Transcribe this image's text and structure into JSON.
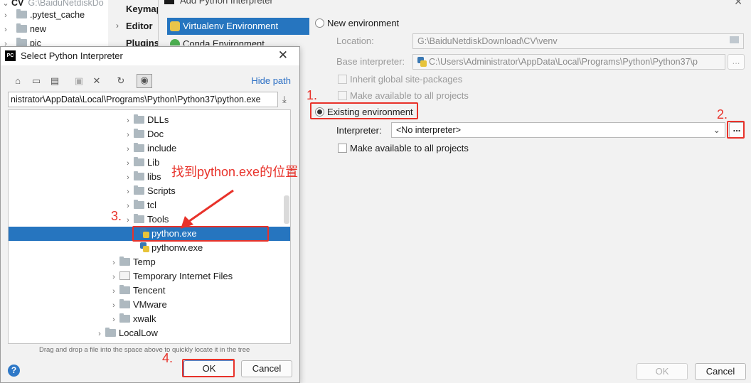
{
  "project_tree": {
    "root_name": "CV",
    "root_path": "G:\\BaiduNetdiskDo",
    "items": [
      ".pytest_cache",
      "new",
      "pic"
    ]
  },
  "settings_nav": {
    "items": [
      "Keymap",
      "Editor",
      "Plugins"
    ]
  },
  "add_dialog": {
    "title": "Add Python Interpreter",
    "nav": [
      "Virtualenv Environment",
      "Conda Environment"
    ],
    "new_env_label": "New environment",
    "location_label": "Location:",
    "location_value": "G:\\BaiduNetdiskDownload\\CV\\venv",
    "base_interp_label": "Base interpreter:",
    "base_interp_value": "C:\\Users\\Administrator\\AppData\\Local\\Programs\\Python\\Python37\\p",
    "inherit_label": "Inherit global site-packages",
    "make_avail_label_1": "Make available to all projects",
    "existing_env_label": "Existing environment",
    "interpreter_label": "Interpreter:",
    "interpreter_value": "<No interpreter>",
    "browse_label": "...",
    "make_avail_label_2": "Make available to all projects",
    "ok_label": "OK",
    "cancel_label": "Cancel"
  },
  "select_dialog": {
    "title": "Select Python Interpreter",
    "hide_path": "Hide path",
    "path_value": "nistrator\\AppData\\Local\\Programs\\Python\\Python37\\python.exe",
    "tree": [
      {
        "label": "DLLs",
        "kind": "folder"
      },
      {
        "label": "Doc",
        "kind": "folder"
      },
      {
        "label": "include",
        "kind": "folder"
      },
      {
        "label": "Lib",
        "kind": "folder"
      },
      {
        "label": "libs",
        "kind": "folder"
      },
      {
        "label": "Scripts",
        "kind": "folder"
      },
      {
        "label": "tcl",
        "kind": "folder"
      },
      {
        "label": "Tools",
        "kind": "folder"
      },
      {
        "label": "python.exe",
        "kind": "python"
      },
      {
        "label": "pythonw.exe",
        "kind": "python"
      },
      {
        "label": "Temp",
        "kind": "folder"
      },
      {
        "label": "Temporary Internet Files",
        "kind": "shortcut"
      },
      {
        "label": "Tencent",
        "kind": "folder"
      },
      {
        "label": "VMware",
        "kind": "folder"
      },
      {
        "label": "xwalk",
        "kind": "folder"
      },
      {
        "label": "LocalLow",
        "kind": "folder"
      }
    ],
    "hint": "Drag and drop a file into the space above to quickly locate it in the tree",
    "ok_label": "OK",
    "cancel_label": "Cancel",
    "help_label": "?"
  },
  "annotations": {
    "step1": "1.",
    "step2": "2.",
    "step3": "3.",
    "step4": "4.",
    "note": "找到python.exe的位置",
    "color": "#e8322a"
  },
  "colors": {
    "selection": "#2675bf",
    "link": "#2a6ec4"
  }
}
